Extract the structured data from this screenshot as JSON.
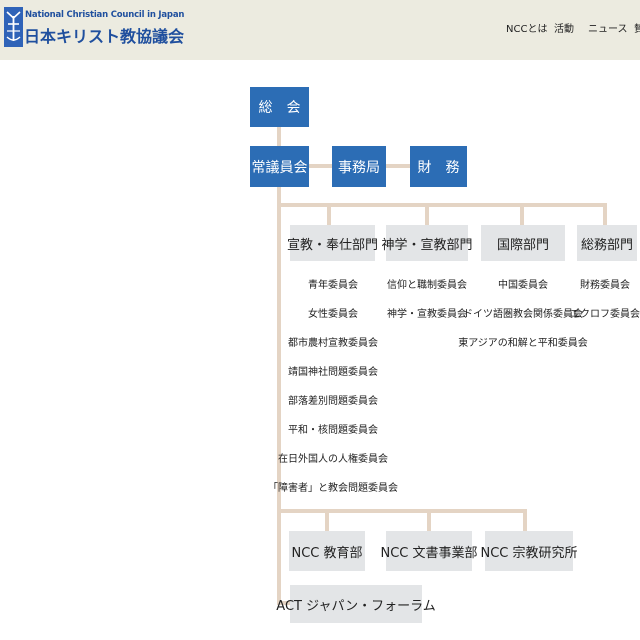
{
  "header": {
    "logo_en": "National Christian Council in Japan",
    "logo_ja": "日本キリスト教協議会",
    "nav": [
      "NCCとは",
      "活動",
      "ニュース",
      "賛"
    ]
  },
  "org": {
    "top": {
      "general_assembly": "総　会",
      "standing_committee": "常議員会",
      "secretariat": "事務局",
      "finance": "財　務"
    },
    "departments": [
      {
        "name": "宣教・奉仕部門",
        "committees": [
          "青年委員会",
          "女性委員会",
          "都市農村宣教委員会",
          "靖国神社問題委員会",
          "部落差別問題委員会",
          "平和・核問題委員会",
          "在日外国人の人権委員会",
          "「障害者」と教会問題委員会"
        ]
      },
      {
        "name": "神学・宣教部門",
        "committees": [
          "信仰と職制委員会",
          "神学・宣教委員会"
        ]
      },
      {
        "name": "国際部門",
        "committees": [
          "中国委員会",
          "ドイツ語圏教会関係委員会",
          "東アジアの和解と平和委員会"
        ]
      },
      {
        "name": "総務部門",
        "committees": [
          "財務委員会",
          "エクロフ委員会"
        ]
      }
    ],
    "affiliates": [
      "NCC 教育部",
      "NCC 文書事業部",
      "NCC 宗教研究所"
    ],
    "forum": "ACT ジャパン・フォーラム"
  },
  "colors": {
    "header_bg": "#ecebe0",
    "brand_blue": "#2c6db5",
    "department_bg": "#e3e5e7",
    "connector": "#e4d4c4"
  }
}
